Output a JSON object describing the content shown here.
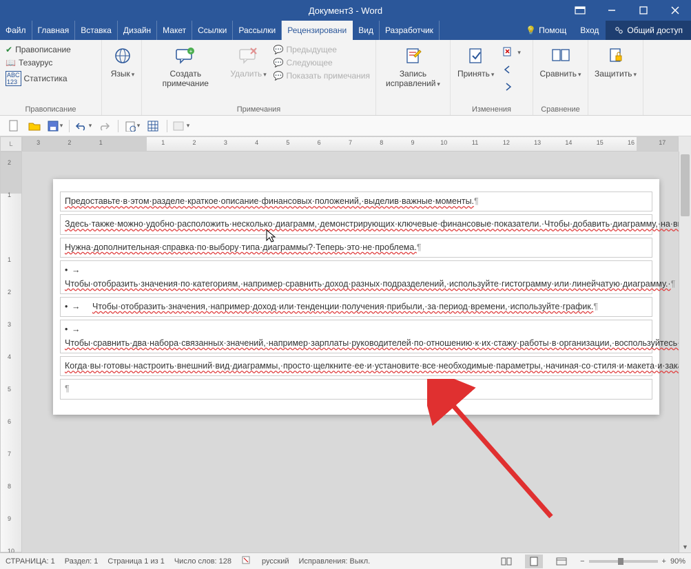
{
  "title": "Документ3 - Word",
  "tabs": {
    "file": "Файл",
    "home": "Главная",
    "insert": "Вставка",
    "design": "Дизайн",
    "layout": "Макет",
    "refs": "Ссылки",
    "mail": "Рассылки",
    "review": "Рецензировани",
    "view": "Вид",
    "dev": "Разработчик"
  },
  "help": "Помощ",
  "login": "Вход",
  "share": "Общий доступ",
  "ribbon": {
    "proof": {
      "spell": "Правописание",
      "thes": "Тезаурус",
      "stats": "Статистика",
      "label": "Правописание"
    },
    "lang": {
      "btn": "Язык"
    },
    "comments": {
      "new": "Создать примечание",
      "del": "Удалить",
      "prev": "Предыдущее",
      "next": "Следующее",
      "show": "Показать примечания",
      "label": "Примечания"
    },
    "track": {
      "btn": "Запись исправлений"
    },
    "changes": {
      "accept": "Принять",
      "label": "Изменения"
    },
    "compare": {
      "btn": "Сравнить",
      "label": "Сравнение"
    },
    "protect": {
      "btn": "Защитить"
    }
  },
  "doc": {
    "p1": "Предоставьте·в·этом·разделе·краткое·описание·финансовых·положений,·выделив·важные·моменты.",
    "p2": "Здесь·также·можно·удобно·расположить·несколько·диаграмм,·демонстрирующих·ключевые·финансовые·показатели.·Чтобы·добавить·диаграмму,·на·вкладке·«Вставка»·выберите·команду·«Диаграмма».·Диаграмма·будет·автоматически·оформлена·в·соответствии·с·видом·отчета.",
    "p3": "Нужна·дополнительная·справка·по·выбору·типа·диаграммы?·Теперь·это·не·проблема.",
    "b1": "Чтобы·отобразить·значения·по·категориям,·например·сравнить·доход·разных·подразделений,·используйте·гистограмму·или·линейчатую·диаграмму.·",
    "b2": "Чтобы·отобразить·значения,·например·доход·или·тенденции·получения·прибыли,·за·период·времени,·используйте·график.",
    "b3": "Чтобы·сравнить·два·набора·связанных·значений,·например·зарплаты·руководителей·по·отношению·к·их·стажу·работы·в·организации,·воспользуйтесь·точечной·диаграммой.·",
    "p4": "Когда·вы·готовы·настроить·внешний·вид·диаграммы,·просто·щелкните·ее·и·установите·все·необходимые·параметры,·начиная·со·стиля·и·макета·и·заканчивая·управлением·данных,·с·помощью·значков·справа."
  },
  "status": {
    "page": "СТРАНИЦА: 1",
    "section": "Раздел: 1",
    "pageof": "Страница 1 из 1",
    "words": "Число слов: 128",
    "lang": "русский",
    "track": "Исправления: Выкл.",
    "zoom": "90%"
  },
  "ruler_h": [
    "3",
    "2",
    "1",
    "",
    "1",
    "2",
    "3",
    "4",
    "5",
    "6",
    "7",
    "8",
    "9",
    "10",
    "11",
    "12",
    "13",
    "14",
    "15",
    "16",
    "17"
  ],
  "ruler_v": [
    "2",
    "1",
    "",
    "1",
    "2",
    "3",
    "4",
    "5",
    "6",
    "7",
    "8",
    "9",
    "10"
  ]
}
